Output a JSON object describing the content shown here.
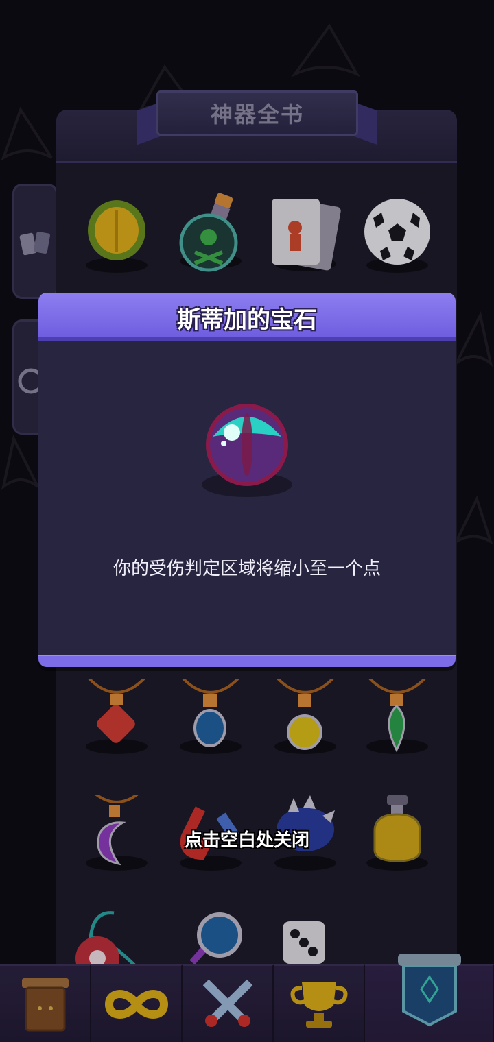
{
  "codex": {
    "title": "神器全书",
    "items_row1": [
      "durian-icon",
      "poison-bottle-icon",
      "joker-card-icon",
      "soccer-ball-icon"
    ],
    "items_row2": [
      "red-pendant-icon",
      "blue-pendant-icon",
      "yellow-pendant-icon",
      "green-pendant-icon"
    ],
    "items_row3": [
      "moon-pendant-icon",
      "magnet-icon",
      "spiked-helmet-icon",
      "yellow-potion-icon"
    ],
    "items_row4": [
      "yoyo-icon",
      "magnifier-icon",
      "dice-icon"
    ]
  },
  "modal": {
    "title": "斯蒂加的宝石",
    "icon": "gem-eye-icon",
    "description": "你的受伤判定区域将缩小至一个点"
  },
  "close_hint": "点击空白处关闭",
  "bottom_nav": [
    "cabinet-icon",
    "infinity-icon",
    "crossed-swords-icon",
    "trophy-icon",
    "banner-icon"
  ],
  "colors": {
    "modal_header": "#7f70ea",
    "modal_body": "#282540",
    "background": "#0e0c14"
  }
}
